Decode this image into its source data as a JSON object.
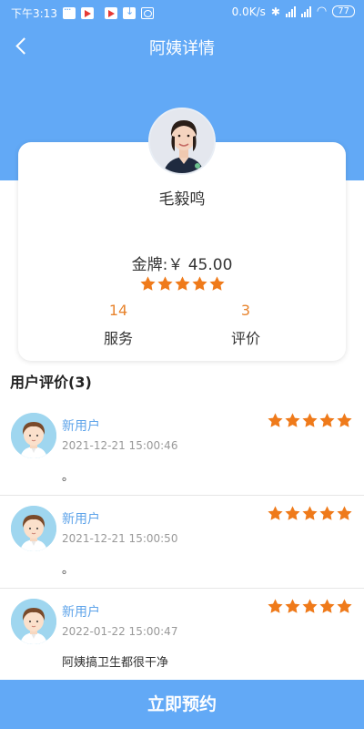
{
  "status_bar": {
    "time": "下午3:13",
    "net_speed": "0.0K/s",
    "signal_label": "4G",
    "battery": "77"
  },
  "header": {
    "title": "阿姨详情"
  },
  "profile": {
    "name": "毛毅鸣",
    "price": "金牌:￥ 45.00",
    "rating": 5,
    "stats": [
      {
        "value": "14",
        "label": "服务"
      },
      {
        "value": "3",
        "label": "评价"
      }
    ]
  },
  "reviews": {
    "title": "用户评价(3)",
    "items": [
      {
        "user": "新用户",
        "time": "2021-12-21 15:00:46",
        "text": "。",
        "rating": 5
      },
      {
        "user": "新用户",
        "time": "2021-12-21 15:00:50",
        "text": "。",
        "rating": 5
      },
      {
        "user": "新用户",
        "time": "2022-01-22 15:00:47",
        "text": "阿姨搞卫生都很干净",
        "rating": 5
      }
    ]
  },
  "actions": {
    "book_label": "立即预约"
  },
  "colors": {
    "primary": "#62a9f6",
    "star": "#ef7a1a",
    "stat_number": "#e8842e",
    "username": "#5fa4ea"
  }
}
